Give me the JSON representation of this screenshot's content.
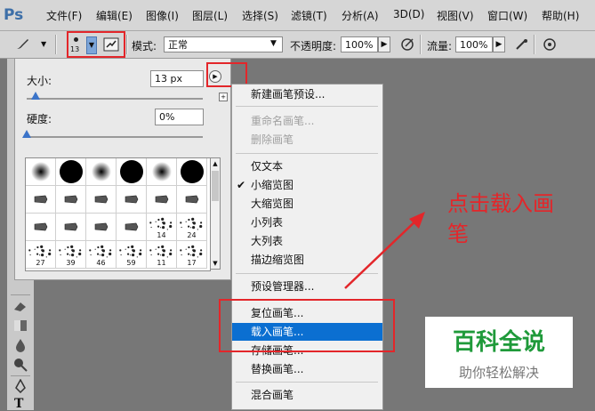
{
  "menubar": {
    "logo": "Ps",
    "items": [
      "文件(F)",
      "编辑(E)",
      "图像(I)",
      "图层(L)",
      "选择(S)",
      "滤镜(T)",
      "分析(A)",
      "3D(D)",
      "视图(V)",
      "窗口(W)",
      "帮助(H)"
    ]
  },
  "options": {
    "brush_size_preview": "13",
    "mode_label": "模式:",
    "mode_value": "正常",
    "opacity_label": "不透明度:",
    "opacity_value": "100%",
    "flow_label": "流量:",
    "flow_value": "100%"
  },
  "brush_panel": {
    "size_label": "大小:",
    "size_value": "13 px",
    "size_fraction": 0.05,
    "hardness_label": "硬度:",
    "hardness_value": "0%",
    "hardness_fraction": 0.0,
    "presets": [
      {
        "kind": "soft",
        "num": ""
      },
      {
        "kind": "hard",
        "num": ""
      },
      {
        "kind": "soft",
        "num": ""
      },
      {
        "kind": "hard",
        "num": ""
      },
      {
        "kind": "soft",
        "num": ""
      },
      {
        "kind": "hard",
        "num": ""
      },
      {
        "kind": "tip",
        "num": ""
      },
      {
        "kind": "tip",
        "num": ""
      },
      {
        "kind": "tip",
        "num": ""
      },
      {
        "kind": "tip",
        "num": ""
      },
      {
        "kind": "tip",
        "num": ""
      },
      {
        "kind": "tip",
        "num": ""
      },
      {
        "kind": "tip",
        "num": ""
      },
      {
        "kind": "tip",
        "num": ""
      },
      {
        "kind": "tip",
        "num": ""
      },
      {
        "kind": "tip",
        "num": ""
      },
      {
        "kind": "splat",
        "num": "14"
      },
      {
        "kind": "splat",
        "num": "24"
      },
      {
        "kind": "splat",
        "num": "27"
      },
      {
        "kind": "splat",
        "num": "39"
      },
      {
        "kind": "splat",
        "num": "46"
      },
      {
        "kind": "splat",
        "num": "59"
      },
      {
        "kind": "splat",
        "num": "11"
      },
      {
        "kind": "splat",
        "num": "17"
      }
    ]
  },
  "context_menu": {
    "items": [
      {
        "label": "新建画笔预设...",
        "state": "normal"
      },
      {
        "label": "重命名画笔...",
        "state": "disabled"
      },
      {
        "label": "删除画笔",
        "state": "disabled"
      },
      {
        "label": "仅文本",
        "state": "normal"
      },
      {
        "label": "小缩览图",
        "state": "checked"
      },
      {
        "label": "大缩览图",
        "state": "normal"
      },
      {
        "label": "小列表",
        "state": "normal"
      },
      {
        "label": "大列表",
        "state": "normal"
      },
      {
        "label": "描边缩览图",
        "state": "normal"
      },
      {
        "label": "预设管理器...",
        "state": "normal"
      },
      {
        "label": "复位画笔...",
        "state": "normal"
      },
      {
        "label": "载入画笔...",
        "state": "selected"
      },
      {
        "label": "存储画笔...",
        "state": "normal"
      },
      {
        "label": "替换画笔...",
        "state": "normal"
      },
      {
        "label": "混合画笔",
        "state": "normal"
      }
    ],
    "check_mark": "✔"
  },
  "annotation": {
    "line1": "点击载入画",
    "line2": "笔"
  },
  "watermark": {
    "title": "百科全说",
    "subtitle": "助你轻松解决"
  },
  "colors": {
    "highlight": "#0b6fd1",
    "annotation_red": "#e3262a",
    "watermark_green": "#1f9a3a"
  }
}
